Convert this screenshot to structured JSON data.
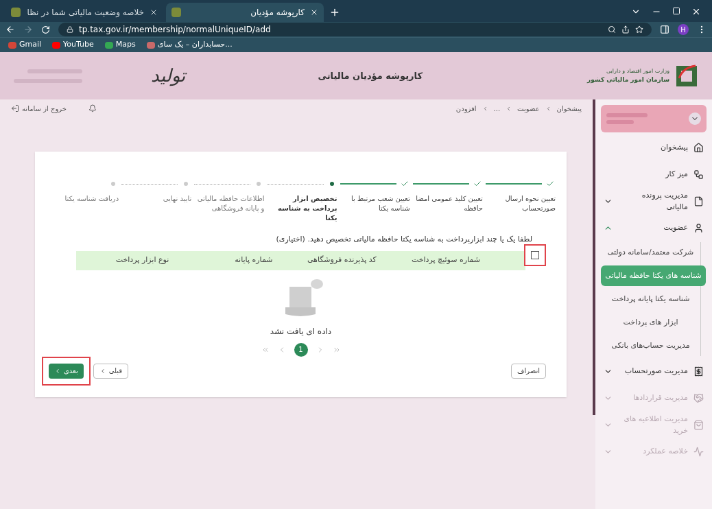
{
  "browser": {
    "tabs": [
      {
        "title": "کارپوشه مؤدیان",
        "selected": true
      },
      {
        "title": "خلاصه وضعیت مالیاتی شما در نظا",
        "selected": false
      }
    ],
    "url": "tp.tax.gov.ir/membership/normalUniqueID/add",
    "profile": "H",
    "bookmarks": [
      "حسابداران – یک سای...",
      "Maps",
      "YouTube",
      "Gmail"
    ]
  },
  "header": {
    "title": "کارپوشه مؤدیان مالیاتی",
    "logo_lines": [
      "وزارت امور اقتصاد و دارایی",
      "سازمان امور مالیاتی کشور"
    ],
    "brand": "تولید"
  },
  "topbar": {
    "breadcrumb": [
      "پیشخوان",
      "عضویت",
      "...",
      "افزودن"
    ],
    "logout": "خروج از سامانه"
  },
  "sidebar": {
    "items": [
      {
        "label": "پیشخوان",
        "disabled": false
      },
      {
        "label": "میز کار",
        "disabled": false
      },
      {
        "label": "مدیریت پرونده مالیاتی",
        "expanded": false,
        "disabled": false
      },
      {
        "label": "عضویت",
        "expanded": true,
        "disabled": false,
        "children": [
          {
            "label": "شرکت معتمد/سامانه دولتی",
            "selected": false
          },
          {
            "label": "شناسه های یکتا حافظه مالیاتی",
            "selected": true
          },
          {
            "label": "شناسه یکتا پایانه پرداخت",
            "selected": false
          },
          {
            "label": "ابزار های پرداخت",
            "selected": false
          },
          {
            "label": "مدیریت حساب‌های بانکی",
            "selected": false
          }
        ]
      },
      {
        "label": "مدیریت صورتحساب",
        "expanded": false,
        "disabled": false
      },
      {
        "label": "مدیریت قراردادها",
        "expanded": false,
        "disabled": true
      },
      {
        "label": "مدیریت اطلاعیه های خرید",
        "expanded": false,
        "disabled": true
      },
      {
        "label": "خلاصه عملکرد",
        "expanded": false,
        "disabled": true
      }
    ]
  },
  "steps": [
    {
      "label": "تعیین نحوه ارسال صورتحساب",
      "done": true,
      "current": false
    },
    {
      "label": "تعیین کلید عمومی امضا حافظه",
      "done": true,
      "current": false
    },
    {
      "label": "تعیین شعب مرتبط با شناسه یکتا",
      "done": true,
      "current": false
    },
    {
      "label": "تخصیص ابزار پرداخت به شناسه یکتا",
      "done": false,
      "current": true
    },
    {
      "label": "اطلاعات حافظه مالیاتی و پایانه فروشگاهی",
      "done": false,
      "current": false
    },
    {
      "label": "تایید نهایی",
      "done": false,
      "current": false
    },
    {
      "label": "دریافت شناسه یکتا",
      "done": false,
      "current": false
    }
  ],
  "instruction": "لطفا یک یا چند ابزارپرداخت به شناسه یکتا حافظه مالیاتی تخصیص دهید. (اختیاری)",
  "table": {
    "select_all": {
      "checked": false,
      "highlighted": true
    },
    "columns": [
      "شماره سوئیچ پرداخت",
      "کد پذیرنده فروشگاهی",
      "شماره پایانه",
      "نوع ابزار پرداخت"
    ],
    "empty_text": "داده ای یافت نشد"
  },
  "pagination": {
    "pages": [
      {
        "label": "1",
        "selected": true
      }
    ]
  },
  "buttons": [
    {
      "label": "انصراف",
      "kind": "cancel",
      "highlighted": false
    },
    {
      "label": "قبلی",
      "kind": "prev",
      "highlighted": false
    },
    {
      "label": "بعدی",
      "kind": "next",
      "highlighted": true
    }
  ]
}
